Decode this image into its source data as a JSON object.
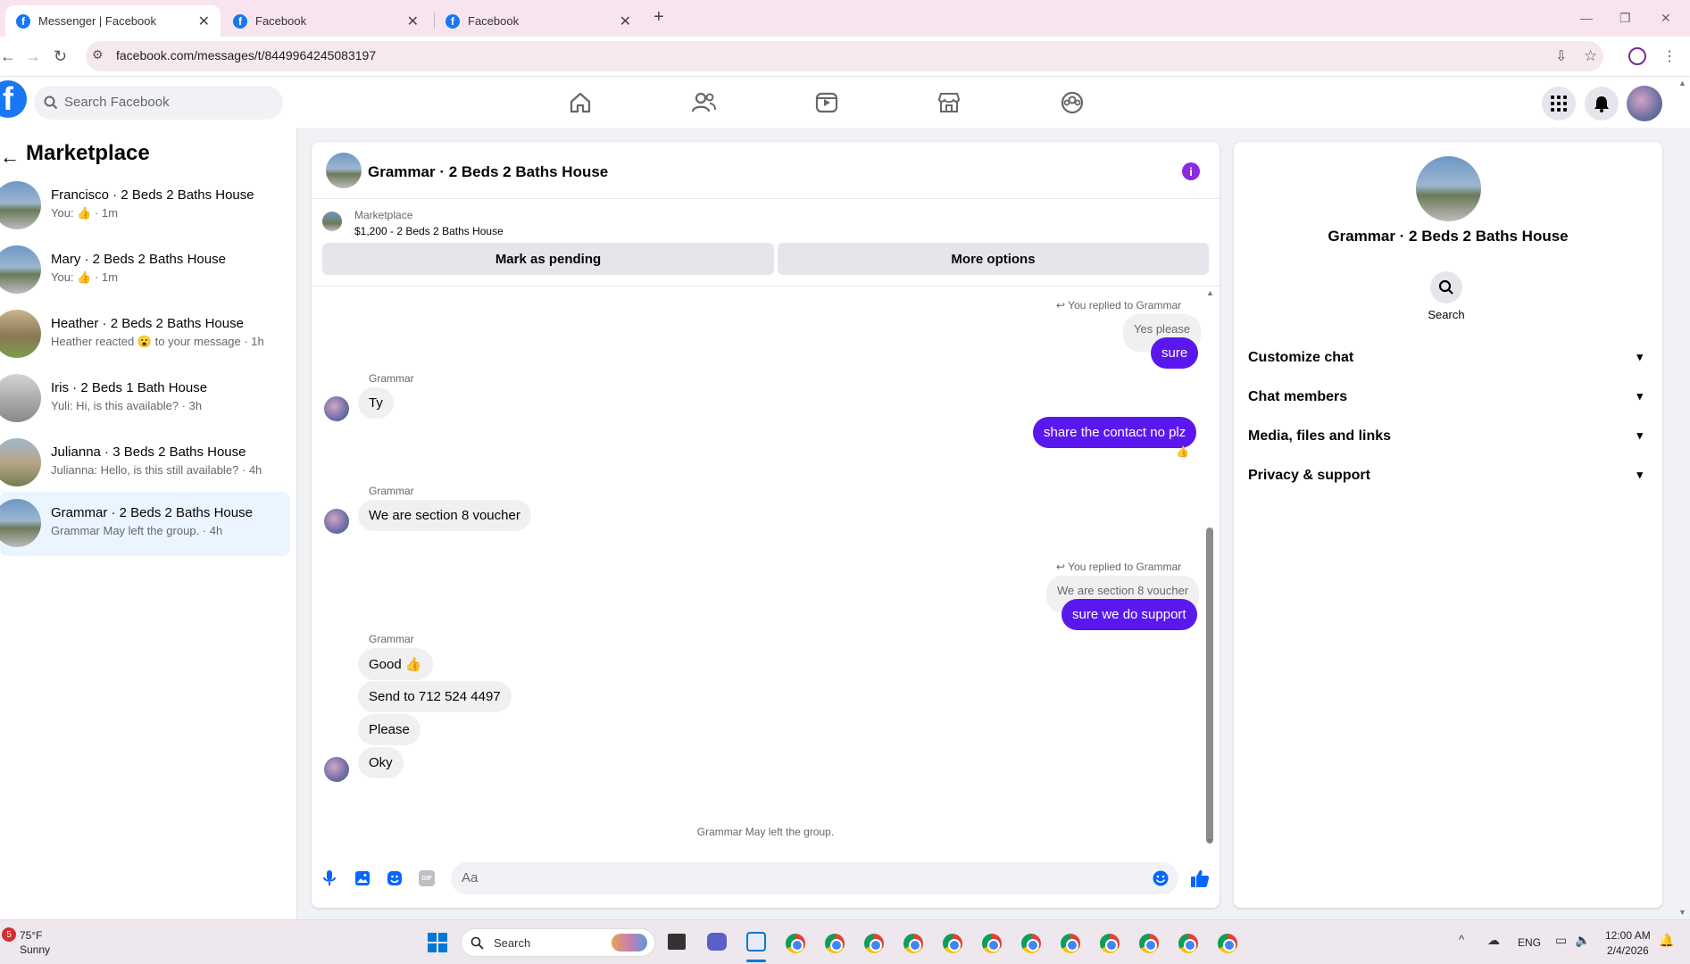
{
  "browser": {
    "tabs": [
      {
        "label": "Messenger | Facebook"
      },
      {
        "label": "Facebook"
      },
      {
        "label": "Facebook"
      }
    ],
    "url": "facebook.com/messages/t/8449964245083197"
  },
  "fb": {
    "search_placeholder": "Search Facebook"
  },
  "left": {
    "title": "Marketplace",
    "conversations": [
      {
        "title": "Francisco · 2 Beds 2 Baths House",
        "sub": "You: 👍 · 1m"
      },
      {
        "title": "Mary · 2 Beds 2 Baths House",
        "sub": "You: 👍 · 1m"
      },
      {
        "title": "Heather · 2 Beds 2 Baths House",
        "sub": "Heather reacted 😮 to your message · 1h"
      },
      {
        "title": "Iris · 2 Beds 1 Bath House",
        "sub": "Yuli: Hi, is this available? · 3h"
      },
      {
        "title": "Julianna · 3 Beds 2 Baths House",
        "sub": "Julianna: Hello, is this still available? · 4h"
      },
      {
        "title": "Grammar · 2 Beds 2 Baths House",
        "sub": "Grammar May left the group. · 4h"
      }
    ]
  },
  "chat": {
    "title": "Grammar · 2 Beds 2 Baths House",
    "marketplace_label": "Marketplace",
    "listing": "$1,200 - 2 Beds 2 Baths House",
    "mark_pending": "Mark as pending",
    "more_options": "More options",
    "messages": {
      "reply1_note": "You replied to Grammar",
      "reply1_quote": "Yes please",
      "reply1": "sure",
      "sender1": "Grammar",
      "m_ty": "Ty",
      "out_contact": "share the contact no plz",
      "reaction": "👍",
      "sender2": "Grammar",
      "m_voucher": "We are section 8 voucher",
      "reply2_note": "You replied to Grammar",
      "reply2_quote": "We are section 8 voucher",
      "reply2": "sure we do support",
      "sender3": "Grammar",
      "m_good": "Good 👍",
      "m_send": "Send to 712 524 4497",
      "m_please": "Please",
      "m_oky": "Oky",
      "system": "Grammar May left the group."
    },
    "composer_placeholder": "Aa"
  },
  "right": {
    "title": "Grammar · 2 Beds 2 Baths House",
    "search_label": "Search",
    "sections": [
      "Customize chat",
      "Chat members",
      "Media, files and links",
      "Privacy & support"
    ]
  },
  "taskbar": {
    "temp": "75°F",
    "weather": "Sunny",
    "weather_badge": "5",
    "search": "Search",
    "lang": "ENG",
    "time": "12:00 AM",
    "date": "2/4/2026"
  }
}
